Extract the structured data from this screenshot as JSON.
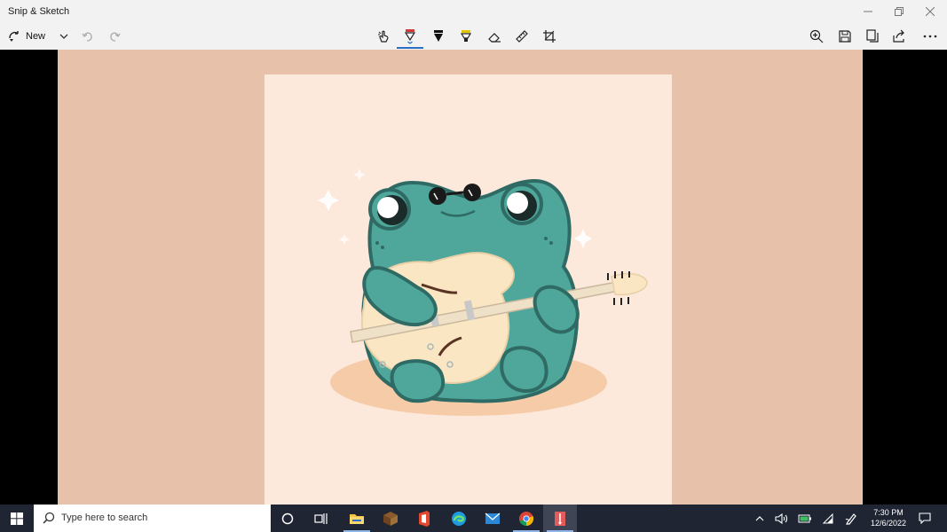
{
  "window": {
    "title": "Snip & Sketch"
  },
  "toolbar": {
    "new_label": "New",
    "tools": [
      "touch-writing-icon",
      "ballpoint-pen-icon",
      "pencil-icon",
      "highlighter-icon",
      "eraser-icon",
      "ruler-icon",
      "crop-icon"
    ],
    "right_tools": [
      "zoom-icon",
      "save-icon",
      "copy-icon",
      "share-icon",
      "more-icon"
    ],
    "selected_tool": "ballpoint-pen-icon"
  },
  "taskbar": {
    "search_placeholder": "Type here to search",
    "clock_time": "7:30 PM",
    "clock_date": "12/6/2022",
    "apps": [
      "cortana-icon",
      "task-view-icon",
      "file-explorer-icon",
      "minecraft-icon",
      "office-icon",
      "edge-icon",
      "mail-icon",
      "chrome-icon",
      "snip-sketch-icon"
    ]
  },
  "colors": {
    "capture_bg": "#e7c1a9",
    "card_bg": "#fde8dc",
    "frog_body": "#4ea79a",
    "frog_outline": "#2f6b64",
    "guitar_body": "#fbe6c4",
    "accent": "#2b6fc4",
    "pen_color": "#d23a3a"
  }
}
